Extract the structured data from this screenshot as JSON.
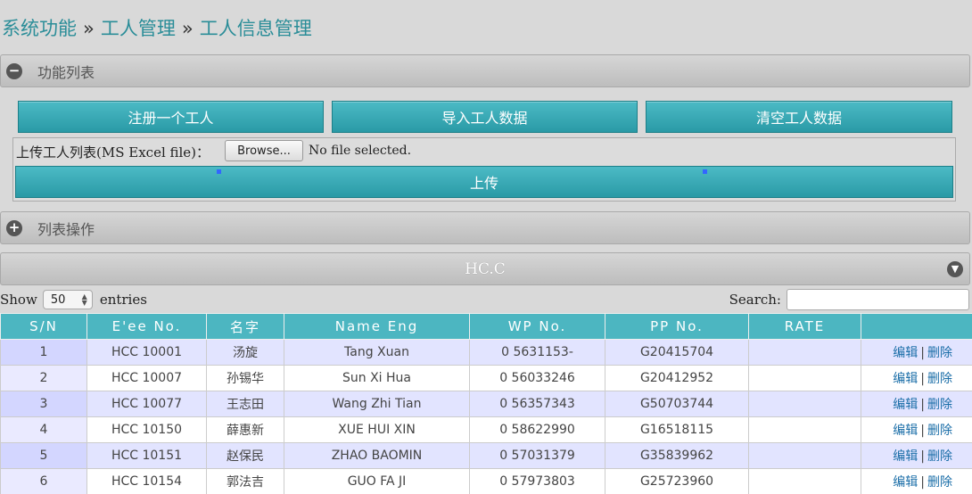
{
  "breadcrumb": {
    "items": [
      "系统功能",
      "工人管理",
      "工人信息管理"
    ],
    "separator": "»"
  },
  "function_panel": {
    "label": "功能列表",
    "icon": "minus-circle-icon"
  },
  "buttons": {
    "register": "注册一个工人",
    "import": "导入工人数据",
    "clear": "清空工人数据"
  },
  "upload": {
    "label": "上传工人列表(MS Excel file)：",
    "browse": "Browse...",
    "status": "No file selected.",
    "submit": "上传"
  },
  "list_panel": {
    "label": "列表操作",
    "icon": "plus-circle-icon"
  },
  "section": {
    "title": "HC.C",
    "icon": "chevron-down-icon"
  },
  "table_controls": {
    "show_label": "Show",
    "entries_value": "50",
    "entries_label": "entries",
    "search_label": "Search:"
  },
  "table": {
    "columns": [
      "S/N",
      "E'ee No.",
      "名字",
      "Name Eng",
      "WP No.",
      "PP No.",
      "RATE",
      ""
    ],
    "rows": [
      {
        "sn": "1",
        "eee": "HCC 10001",
        "name": "汤旋",
        "name_eng": "Tang Xuan",
        "wp": "0 5631153-",
        "pp": "G20415704",
        "rate": ""
      },
      {
        "sn": "2",
        "eee": "HCC 10007",
        "name": "孙锡华",
        "name_eng": "Sun Xi Hua",
        "wp": "0 56033246",
        "pp": "G20412952",
        "rate": ""
      },
      {
        "sn": "3",
        "eee": "HCC 10077",
        "name": "王志田",
        "name_eng": "Wang Zhi Tian",
        "wp": "0 56357343",
        "pp": "G50703744",
        "rate": ""
      },
      {
        "sn": "4",
        "eee": "HCC 10150",
        "name": "薛惠新",
        "name_eng": "XUE HUI XIN",
        "wp": "0 58622990",
        "pp": "G16518115",
        "rate": ""
      },
      {
        "sn": "5",
        "eee": "HCC 10151",
        "name": "赵保民",
        "name_eng": "ZHAO BAOMIN",
        "wp": "0 57031379",
        "pp": "G35839962",
        "rate": ""
      },
      {
        "sn": "6",
        "eee": "HCC 10154",
        "name": "郭法吉",
        "name_eng": "GUO FA JI",
        "wp": "0 57973803",
        "pp": "G25723960",
        "rate": ""
      }
    ],
    "actions": {
      "edit": "编辑",
      "separator": "|",
      "delete": "删除"
    }
  },
  "colors": {
    "accent": "#2a9aa6",
    "header": "#4cb6c1",
    "link": "#1b6ea8",
    "odd_row": "#e2e4ff"
  }
}
